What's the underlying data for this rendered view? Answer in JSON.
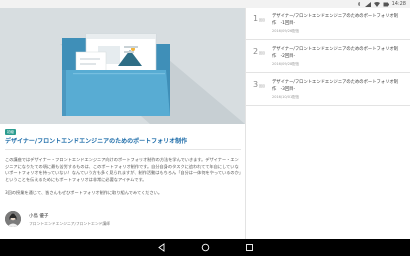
{
  "status_bar": {
    "time": "14:28",
    "icons": [
      "bluetooth-icon",
      "signal-icon",
      "wifi-icon",
      "battery-icon"
    ]
  },
  "article": {
    "tag": "初級",
    "title": "デザイナー/フロントエンドエンジニアのためのポートフォリオ制作",
    "body_1": "この講座ではデザイナー・フロントエンドエンジニア向けのポートフォリオ制作の方法を学んでいきます。デザイナー・エンジニアになりたての頃に最も苦労するものは、このポートフォリオ制作です。自分自身のタスクに追われてて年自にしていないポートフォリオを持っていない！なんていう方も多く見られますが、制作活動はもちろん「自分は一体何をやっているのか」ということを伝えるためにもポートフォリオは非常に必要なアイテムです。",
    "body_2": "3回の授業を通じて、皆さんもぜひポートフォリオ制作に取り組んでみてください。",
    "author_name": "小島 優子",
    "author_role": "フロントエンドエンジニア/フロントエンド講師"
  },
  "lessons": [
    {
      "number": "1",
      "unit": "回目",
      "title": "デザイナー/フロントエンドエンジニアのためのポートフォリオ制作　-1回目-",
      "date": "2016/09/26配信"
    },
    {
      "number": "2",
      "unit": "回目",
      "title": "デザイナー/フロントエンドエンジニアのためのポートフォリオ制作　-2回目-",
      "date": "2016/09/28配信"
    },
    {
      "number": "3",
      "unit": "回目",
      "title": "デザイナー/フロントエンドエンジニアのためのポートフォリオ制作　-3回目-",
      "date": "2016/10/01配信"
    }
  ],
  "nav": {
    "buttons": [
      "back-icon",
      "home-icon",
      "recents-icon"
    ]
  },
  "colors": {
    "accent": "#2b9c8f",
    "title_blue": "#1a6aa8",
    "hero_bg": "#d7dde0",
    "folder": "#4fa0c8"
  }
}
